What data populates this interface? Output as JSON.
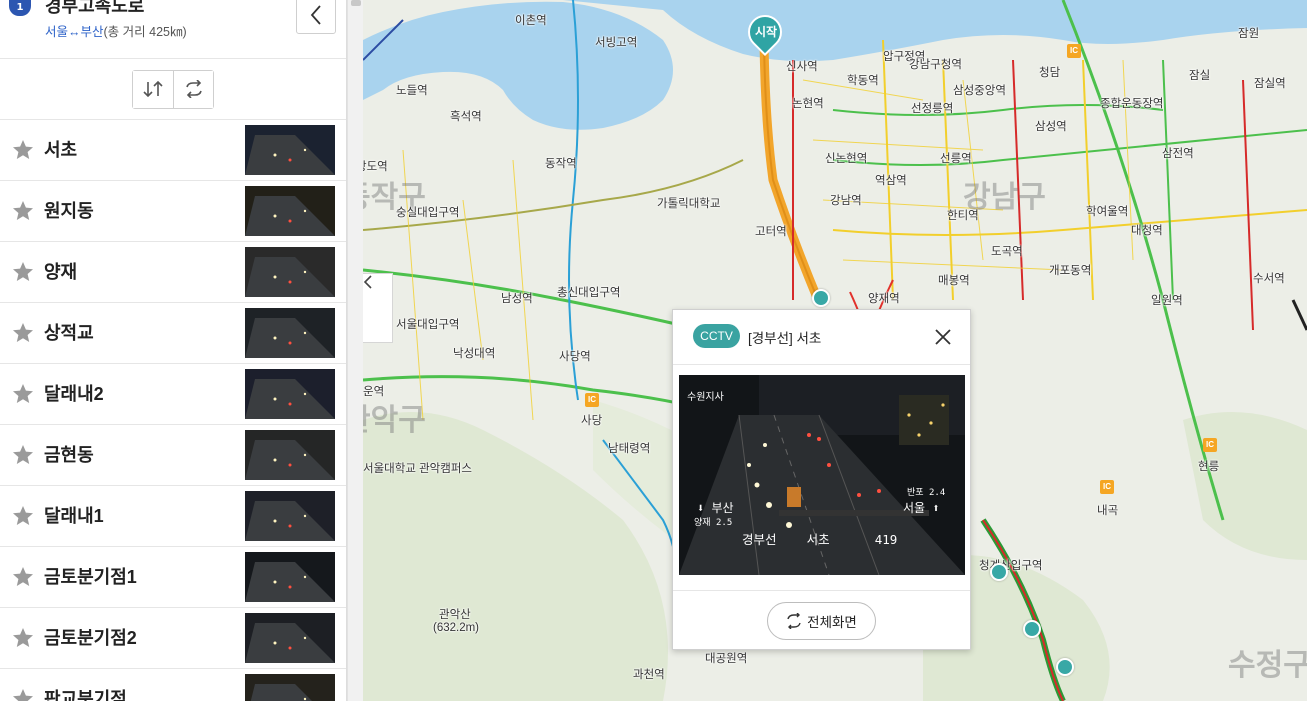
{
  "route": {
    "badge": "1",
    "name": "경부고속도로",
    "origin_dest": "서울↔부산",
    "distance": "(총 거리 425㎞)"
  },
  "cctv_list": [
    {
      "name": "서초"
    },
    {
      "name": "원지동"
    },
    {
      "name": "양재"
    },
    {
      "name": "상적교"
    },
    {
      "name": "달래내2"
    },
    {
      "name": "금현동"
    },
    {
      "name": "달래내1"
    },
    {
      "name": "금토분기점1"
    },
    {
      "name": "금토분기점2"
    },
    {
      "name": "판교분기점"
    }
  ],
  "map": {
    "start_label": "시작",
    "stations": [
      {
        "name": "이촌역"
      },
      {
        "name": "서빙고역"
      },
      {
        "name": "신사역"
      },
      {
        "name": "압구정역"
      },
      {
        "name": "노들역"
      },
      {
        "name": "흑석역"
      },
      {
        "name": "논현역"
      },
      {
        "name": "학동역"
      },
      {
        "name": "강남구청역"
      },
      {
        "name": "삼성중앙역"
      },
      {
        "name": "선정릉역"
      },
      {
        "name": "종합운동장역"
      },
      {
        "name": "상도역"
      },
      {
        "name": "동작역"
      },
      {
        "name": "신논현역"
      },
      {
        "name": "선릉역"
      },
      {
        "name": "삼성역"
      },
      {
        "name": "삼전역"
      },
      {
        "name": "숭실대입구역"
      },
      {
        "name": "가톨릭대학교"
      },
      {
        "name": "강남역"
      },
      {
        "name": "역삼역"
      },
      {
        "name": "한티역"
      },
      {
        "name": "학여울역"
      },
      {
        "name": "고터역"
      },
      {
        "name": "도곡역"
      },
      {
        "name": "대청역"
      },
      {
        "name": "남성역"
      },
      {
        "name": "총신대입구역"
      },
      {
        "name": "양재역"
      },
      {
        "name": "매봉역"
      },
      {
        "name": "개포동역"
      },
      {
        "name": "수서역"
      },
      {
        "name": "서울대입구역"
      },
      {
        "name": "낙성대역"
      },
      {
        "name": "사당역"
      },
      {
        "name": "일원역"
      },
      {
        "name": "남태령역"
      },
      {
        "name": "서울대학교 관악캠퍼스"
      },
      {
        "name": "관악산"
      },
      {
        "name": "(632.2m)"
      },
      {
        "name": "과천역"
      },
      {
        "name": "대공원역"
      },
      {
        "name": "청계산입구역"
      },
      {
        "name": "현릉"
      },
      {
        "name": "내곡"
      },
      {
        "name": "잠실"
      },
      {
        "name": "잠실역"
      },
      {
        "name": "청담"
      },
      {
        "name": "운역"
      },
      {
        "name": "사당"
      },
      {
        "name": "잠원"
      }
    ],
    "districts": [
      "강남구",
      "동작구",
      "관악구",
      "수정구"
    ],
    "ic_label": "IC"
  },
  "popup": {
    "badge": "CCTV",
    "title": "[경부선] 서초",
    "video_overlay": {
      "corner": "수원지사",
      "left_dir": "부산",
      "left_sub": "양재 2.5",
      "right_top": "반포 2.4",
      "right_dir": "서울",
      "bottom": "경부선    서초      419"
    },
    "fullscreen_label": "전체화면"
  },
  "icons": {
    "back": "chevron-left-icon",
    "swap": "swap-vertical-icon",
    "refresh": "refresh-icon",
    "star": "star-icon",
    "close": "close-icon",
    "fullscreen": "fullscreen-icon"
  },
  "colors": {
    "accent": "#38a8a6",
    "route_highway": "#f2a52b",
    "traffic_green": "#4cc04c",
    "traffic_yellow": "#f2cf2c",
    "traffic_red": "#d62a2a",
    "water": "#a8d4ef"
  }
}
